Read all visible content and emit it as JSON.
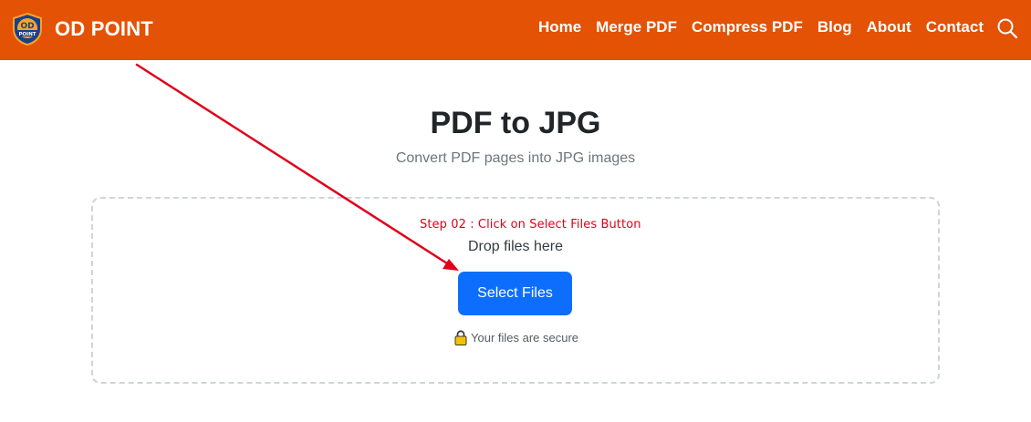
{
  "header": {
    "brand_name": "OD POINT",
    "logo_text_top": "OD",
    "logo_text_bottom": "POINT",
    "nav": [
      {
        "label": "Home"
      },
      {
        "label": "Merge PDF"
      },
      {
        "label": "Compress PDF"
      },
      {
        "label": "Blog"
      },
      {
        "label": "About"
      },
      {
        "label": "Contact"
      }
    ],
    "search_icon": "search-icon",
    "background_color": "#e35205"
  },
  "main": {
    "title": "PDF to JPG",
    "subtitle": "Convert PDF pages into JPG images"
  },
  "upload": {
    "annotation_note": "Step 02 : Click on Select Files Button",
    "drop_text": "Drop files here",
    "select_button_label": "Select Files",
    "secure_text": "Your files are secure",
    "lock_icon": "lock-icon",
    "button_color": "#0d6efd",
    "annotation_color": "#e0001a"
  }
}
